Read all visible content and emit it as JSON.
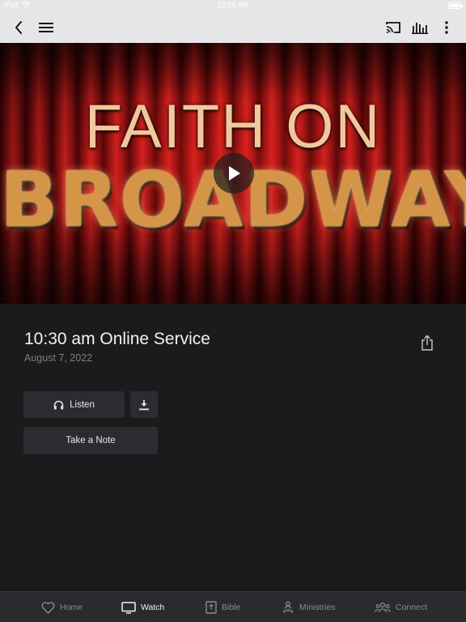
{
  "status_bar": {
    "device": "iPad",
    "time": "10:26 AM"
  },
  "nav": {
    "back_icon": "chevron-left-icon",
    "menu_icon": "hamburger-icon",
    "cast_icon": "cast-icon",
    "audio_icon": "equalizer-icon",
    "more_icon": "more-vertical-icon"
  },
  "hero": {
    "line1": "FAITH ON",
    "line2": "BROADWAY",
    "play_icon": "play-icon"
  },
  "sermon": {
    "title": "10:30 am Online Service",
    "date": "August 7, 2022"
  },
  "actions": {
    "listen_label": "Listen",
    "note_label": "Take a Note"
  },
  "tabs": [
    {
      "label": "Home",
      "icon": "heart-icon"
    },
    {
      "label": "Watch",
      "icon": "tv-icon"
    },
    {
      "label": "Bible",
      "icon": "bible-icon"
    },
    {
      "label": "Ministries",
      "icon": "people-icon"
    },
    {
      "label": "Connect",
      "icon": "group-icon"
    }
  ],
  "colors": {
    "background": "#1a1b1d",
    "nav_background": "#e6e6e9",
    "button_background": "#2b2c2f",
    "tab_active": "#f2f2f2",
    "tab_inactive": "#8a8c91"
  }
}
